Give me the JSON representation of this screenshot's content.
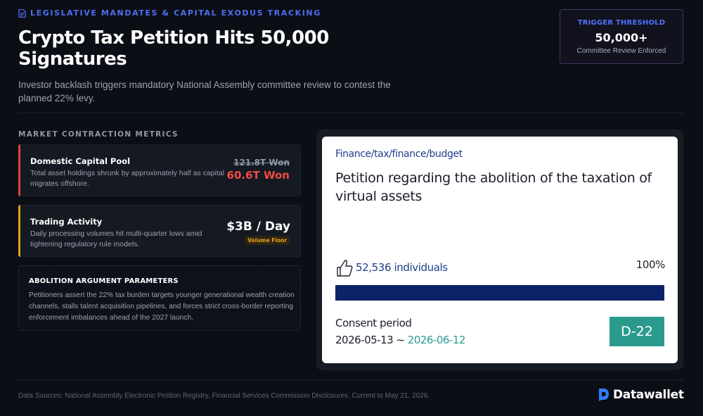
{
  "header": {
    "kicker": "LEGISLATIVE MANDATES & CAPITAL EXODUS TRACKING",
    "title": "Crypto Tax Petition Hits 50,000 Signatures",
    "subtitle": "Investor backlash triggers mandatory National Assembly committee review to contest the planned 22% levy."
  },
  "threshold": {
    "label": "TRIGGER THRESHOLD",
    "value": "50,000+",
    "note": "Committee Review Enforced"
  },
  "metrics_section": {
    "label": "MARKET CONTRACTION METRICS",
    "capital": {
      "title": "Domestic Capital Pool",
      "desc": "Total asset holdings shrunk by approximately half as capital migrates offshore.",
      "old_value": "121.8T Won",
      "new_value": "60.6T Won",
      "accent": "#e0433a"
    },
    "trading": {
      "title": "Trading Activity",
      "desc": "Daily processing volumes hit multi-quarter lows amid tightening regulatory rule models.",
      "value": "$3B / Day",
      "badge": "Volume Floor",
      "accent": "#e2a21d"
    }
  },
  "argument": {
    "title": "ABOLITION ARGUMENT PARAMETERS",
    "text": "Petitioners assert the 22% tax burden targets younger generational wealth creation channels, stalls talent acquisition pipelines, and forces strict cross-border reporting enforcement imbalances ahead of the 2027 launch."
  },
  "petition": {
    "category": "Finance/tax/finance/budget",
    "title": "Petition regarding the abolition of the taxation of virtual assets",
    "count": "52,536 individuals",
    "percent_label": "100%",
    "progress": 1.0,
    "period_label": "Consent period",
    "start_date": "2026-05-13",
    "separator": " ~ ",
    "end_date": "2026-06-12",
    "dday": "D-22",
    "icons": [
      "thumbs-up-icon"
    ]
  },
  "footer": {
    "sources": "Data Sources: National Assembly Electronic Petition Registry, Financial Services Commission Disclosures. Current to May 21, 2026."
  },
  "brand": {
    "name": "Datawallet",
    "accent": "#2f7cf6"
  }
}
